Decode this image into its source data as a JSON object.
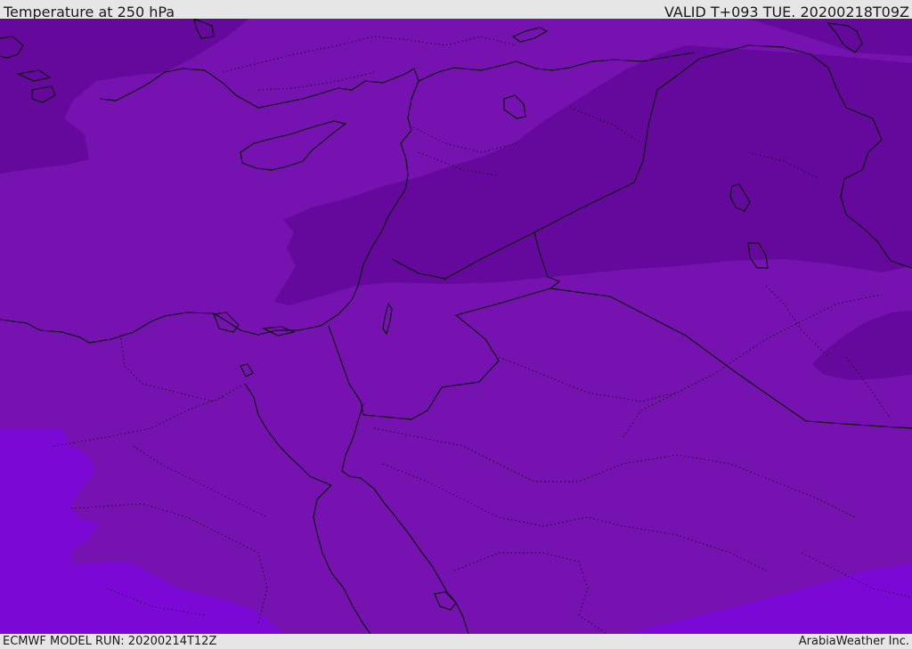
{
  "header": {
    "title": "Temperature at 250 hPa",
    "valid": "VALID T+093 TUE. 20200218T09Z"
  },
  "footer": {
    "model_run": "ECMWF MODEL RUN: 20200214T12Z",
    "credit": "ArabiaWeather Inc."
  },
  "colors": {
    "band_mid": "#7612b0",
    "band_cold": "#65089c",
    "band_warm": "#7c08d6",
    "coastline": "#000000"
  }
}
